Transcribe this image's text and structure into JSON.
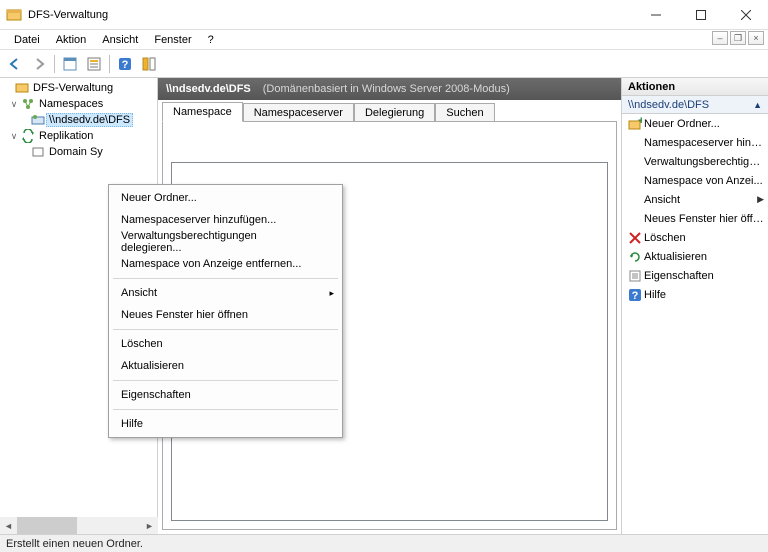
{
  "window": {
    "title": "DFS-Verwaltung"
  },
  "menubar": [
    "Datei",
    "Aktion",
    "Ansicht",
    "Fenster",
    "?"
  ],
  "tree": {
    "root": "DFS-Verwaltung",
    "ns_group": "Namespaces",
    "ns_item": "\\\\ndsedv.de\\DFS",
    "rep_group": "Replikation",
    "rep_item": "Domain Sy"
  },
  "center": {
    "path": "\\\\ndsedv.de\\DFS",
    "subtitle": "(Domänenbasiert in Windows Server 2008-Modus)",
    "tabs": [
      "Namespace",
      "Namespaceserver",
      "Delegierung",
      "Suchen"
    ]
  },
  "context_menu": {
    "g1": [
      "Neuer Ordner...",
      "Namespaceserver hinzufügen...",
      "Verwaltungsberechtigungen delegieren...",
      "Namespace von Anzeige entfernen..."
    ],
    "g2": [
      {
        "label": "Ansicht",
        "sub": true
      },
      {
        "label": "Neues Fenster hier öffnen"
      }
    ],
    "g3": [
      "Löschen",
      "Aktualisieren"
    ],
    "g4": [
      "Eigenschaften"
    ],
    "g5": [
      "Hilfe"
    ]
  },
  "actions": {
    "header": "Aktionen",
    "subheader": "\\\\ndsedv.de\\DFS",
    "items": [
      {
        "icon": "folder-plus",
        "label": "Neuer Ordner..."
      },
      {
        "icon": "",
        "label": "Namespaceserver hinz..."
      },
      {
        "icon": "",
        "label": "Verwaltungsberechtigu..."
      },
      {
        "icon": "",
        "label": "Namespace von Anzei..."
      },
      {
        "icon": "",
        "label": "Ansicht",
        "arrow": true
      },
      {
        "icon": "",
        "label": "Neues Fenster hier öffn..."
      },
      {
        "icon": "delete",
        "label": "Löschen"
      },
      {
        "icon": "refresh",
        "label": "Aktualisieren"
      },
      {
        "icon": "props",
        "label": "Eigenschaften"
      },
      {
        "icon": "help",
        "label": "Hilfe"
      }
    ]
  },
  "statusbar": "Erstellt einen neuen Ordner."
}
